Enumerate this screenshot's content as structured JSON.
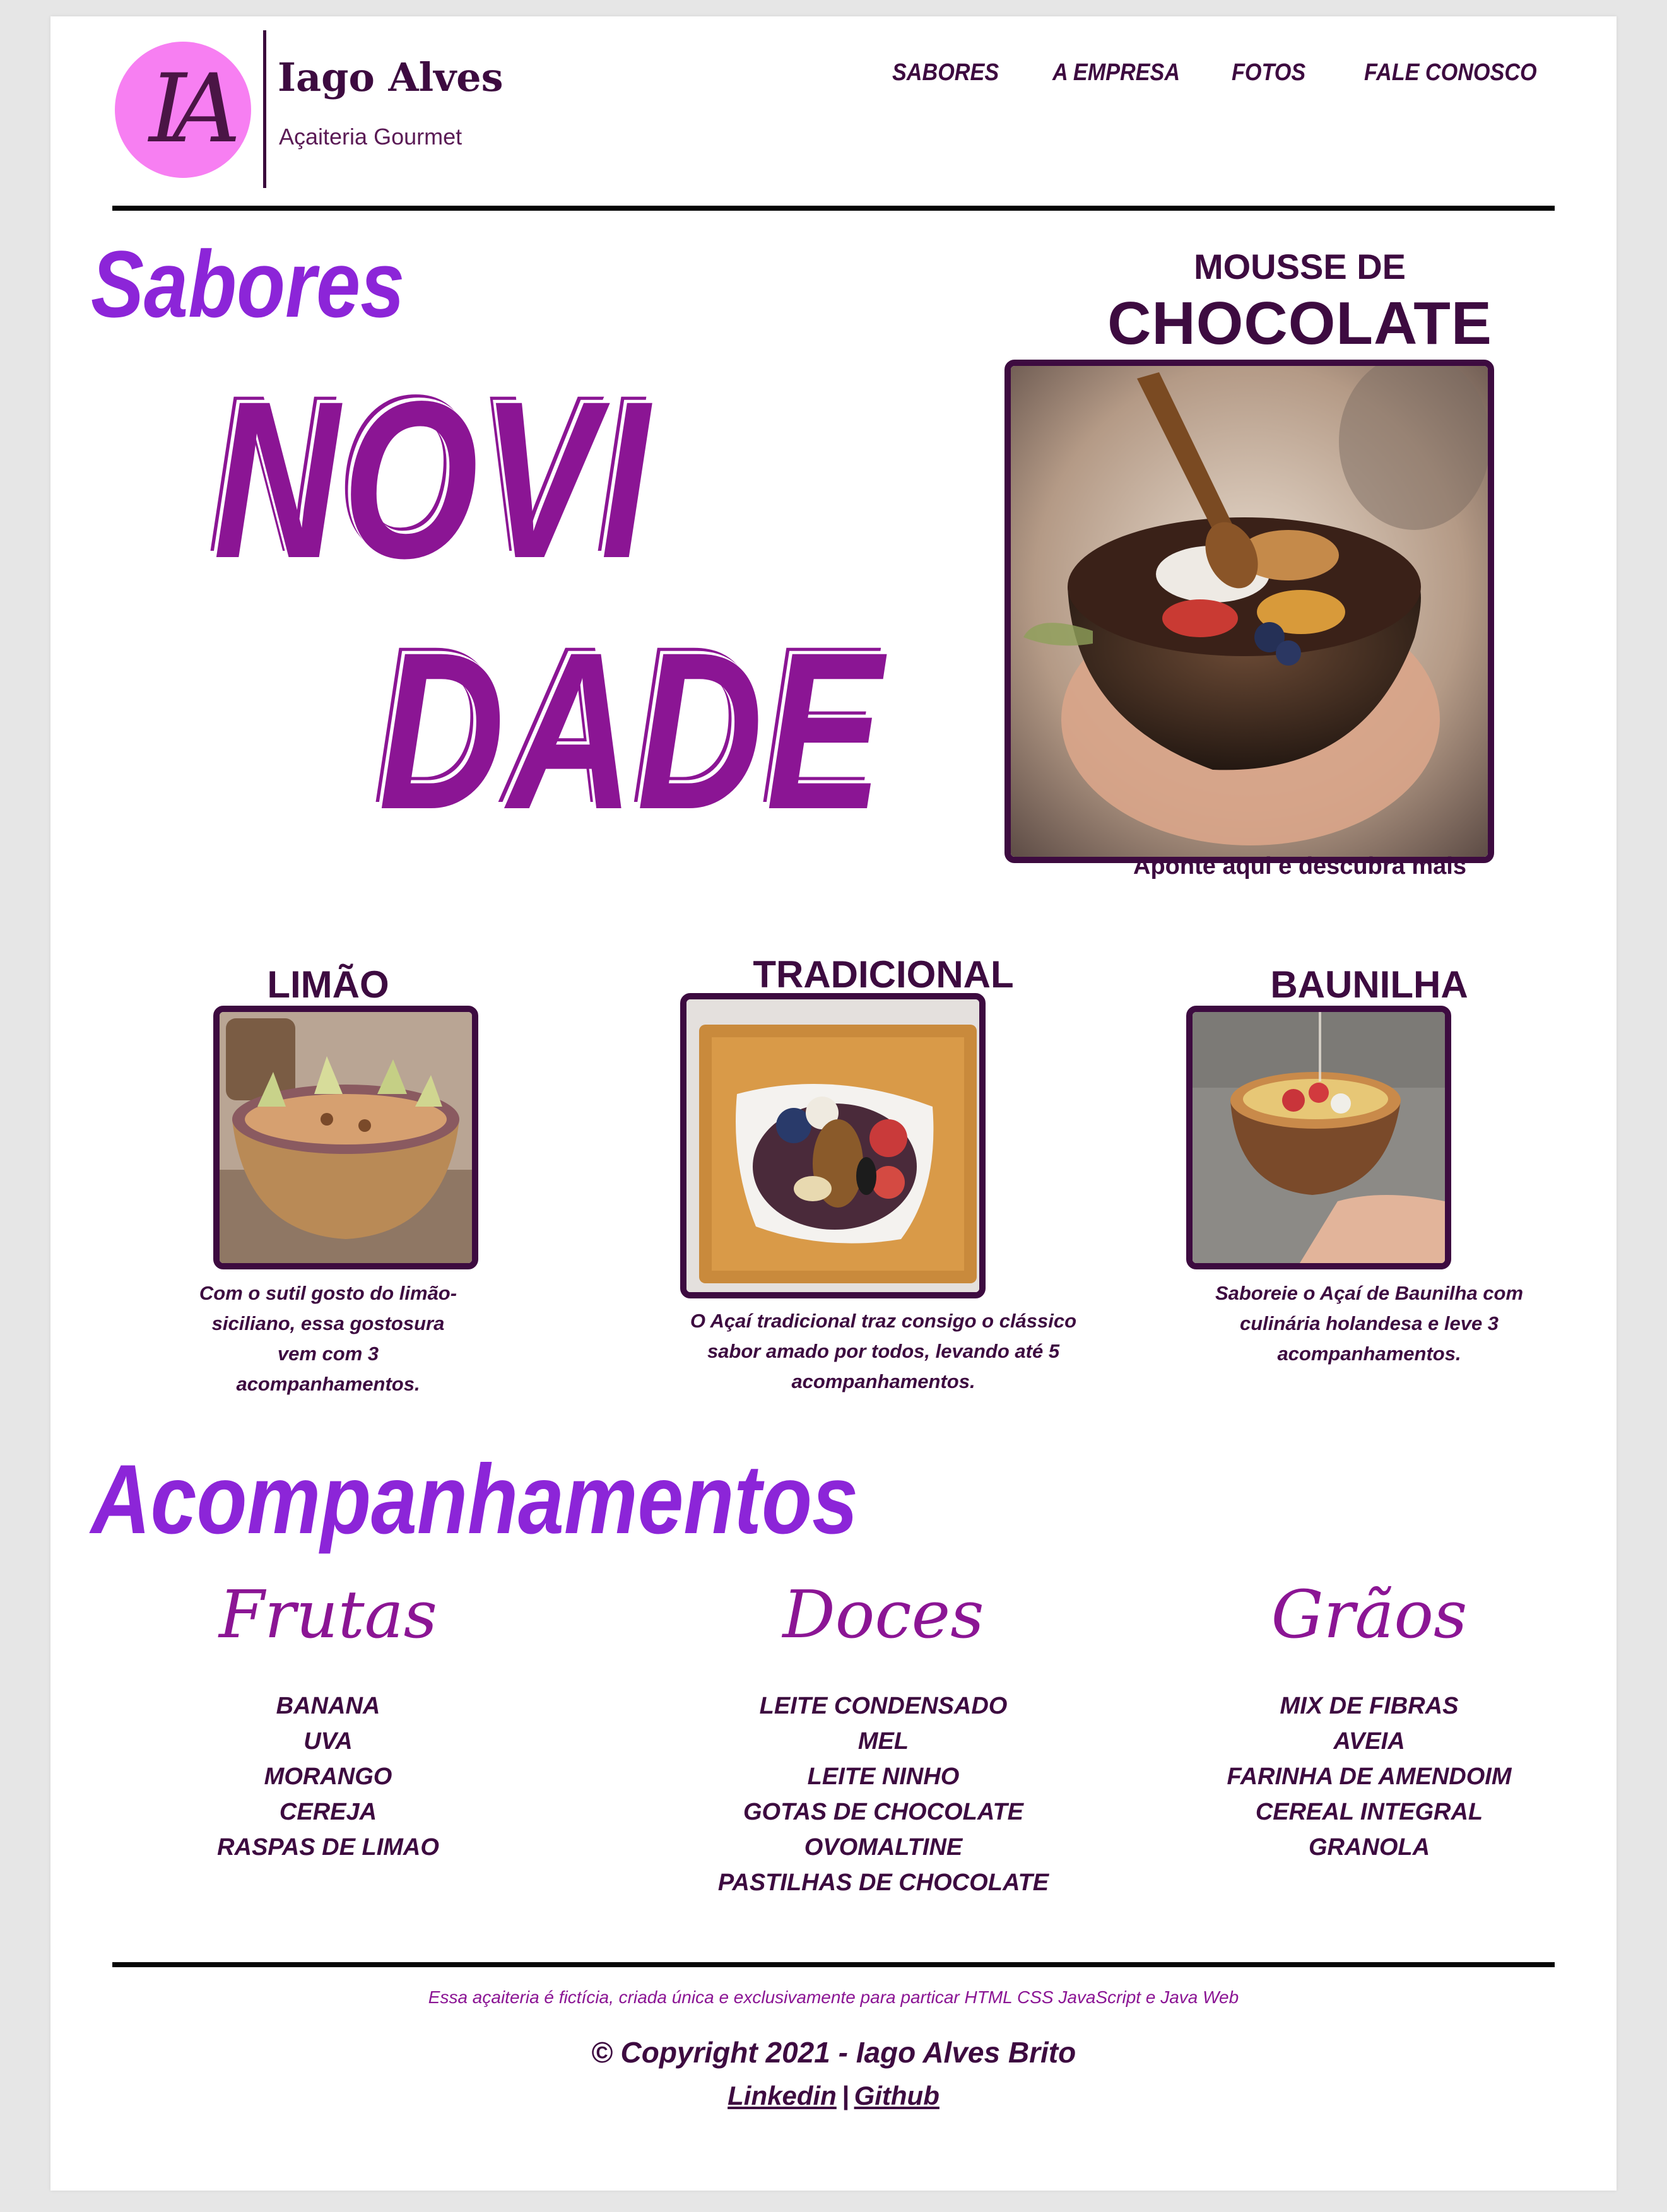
{
  "header": {
    "logo_monogram": "IA",
    "brand_name": "Iago Alves",
    "brand_subtitle": "Açaiteria Gourmet",
    "nav": [
      "SABORES",
      "A EMPRESA",
      "FOTOS",
      "FALE CONOSCO"
    ]
  },
  "sabores": {
    "title": "Sabores",
    "highlight_line1": "NOVI",
    "highlight_line2": "DADE",
    "featured": {
      "name_small": "MOUSSE DE",
      "name_big": "CHOCOLATE",
      "caption": "Aponte aqui e descubra mais"
    },
    "flavors": [
      {
        "name": "LIMÃO",
        "description": "Com o sutil gosto do limão-siciliano, essa gostosura vem com 3 acompanhamentos."
      },
      {
        "name": "TRADICIONAL",
        "description": "O Açaí tradicional traz consigo o clássico sabor amado por todos, levando até 5 acompanhamentos."
      },
      {
        "name": "BAUNILHA",
        "description": "Saboreie o Açaí de Baunilha com culinária holandesa e leve 3 acompanhamentos."
      }
    ]
  },
  "acompanhamentos": {
    "title": "Acompanhamentos",
    "columns": [
      {
        "title": "Frutas",
        "items": [
          "BANANA",
          "UVA",
          "MORANGO",
          "CEREJA",
          "RASPAS DE LIMAO"
        ]
      },
      {
        "title": "Doces",
        "items": [
          "LEITE CONDENSADO",
          "MEL",
          "LEITE NINHO",
          "GOTAS DE CHOCOLATE",
          "OVOMALTINE",
          "PASTILHAS DE CHOCOLATE"
        ]
      },
      {
        "title": "Grãos",
        "items": [
          "MIX DE FIBRAS",
          "AVEIA",
          "FARINHA DE AMENDOIM",
          "CEREAL INTEGRAL",
          "GRANOLA"
        ]
      }
    ]
  },
  "footer": {
    "note": "Essa açaiteria é fictícia, criada única e exclusivamente para particar HTML CSS JavaScript e Java Web",
    "copyright": "© Copyright 2021 - Iago Alves Brito",
    "link_linkedin": "Linkedin",
    "separator": "|",
    "link_github": "Github"
  },
  "colors": {
    "accent_purple": "#8c25d8",
    "magenta": "#8b1594",
    "dark_plum": "#3d0b40",
    "logo_pink": "#f77ff2"
  }
}
